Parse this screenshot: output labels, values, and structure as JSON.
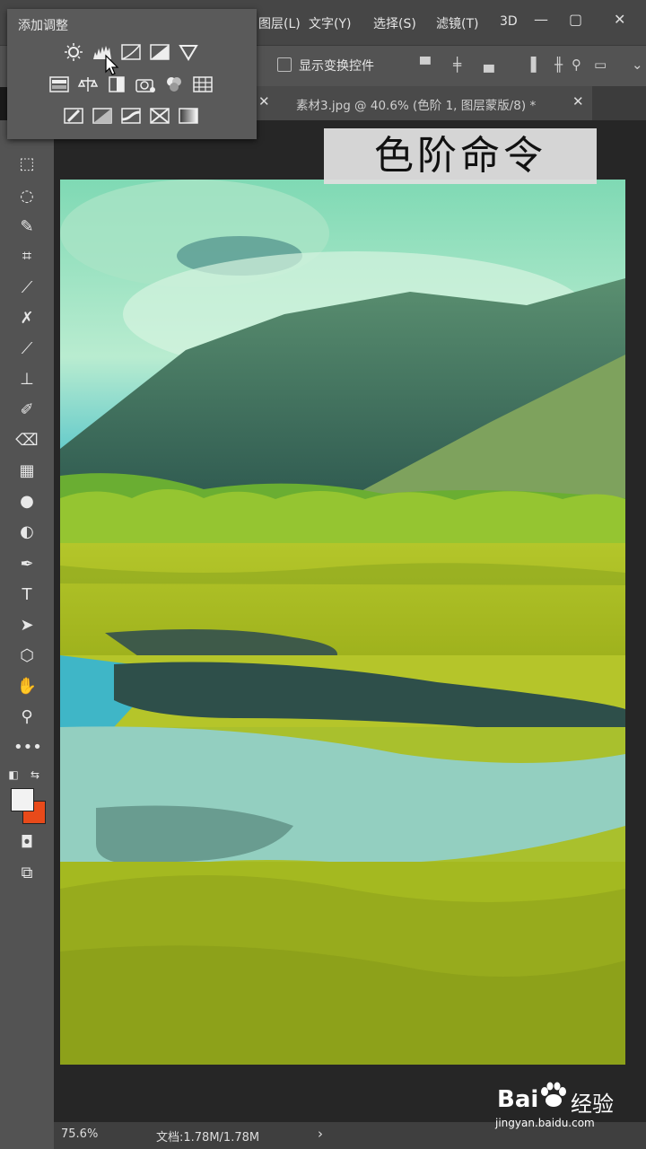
{
  "menu": {
    "items": [
      "图层(L)",
      "文字(Y)",
      "选择(S)",
      "滤镜(T)",
      "3D"
    ]
  },
  "options_bar": {
    "show_transform_label": "显示变换控件"
  },
  "document_tab": {
    "title": "素材3.jpg @ 40.6% (色阶 1, 图层蒙版/8) *"
  },
  "adjustments_panel": {
    "title": "添加调整"
  },
  "caption": "色阶命令",
  "status": {
    "zoom": "75.6%",
    "doc_size": "文档:1.78M/1.78M",
    "arrow": "›"
  },
  "colors": {
    "foreground": "#f2f2f2",
    "background": "#e84a1a"
  },
  "watermark": {
    "brand": "Bai",
    "brand2": "经验",
    "url": "jingyan.baidu.com"
  }
}
